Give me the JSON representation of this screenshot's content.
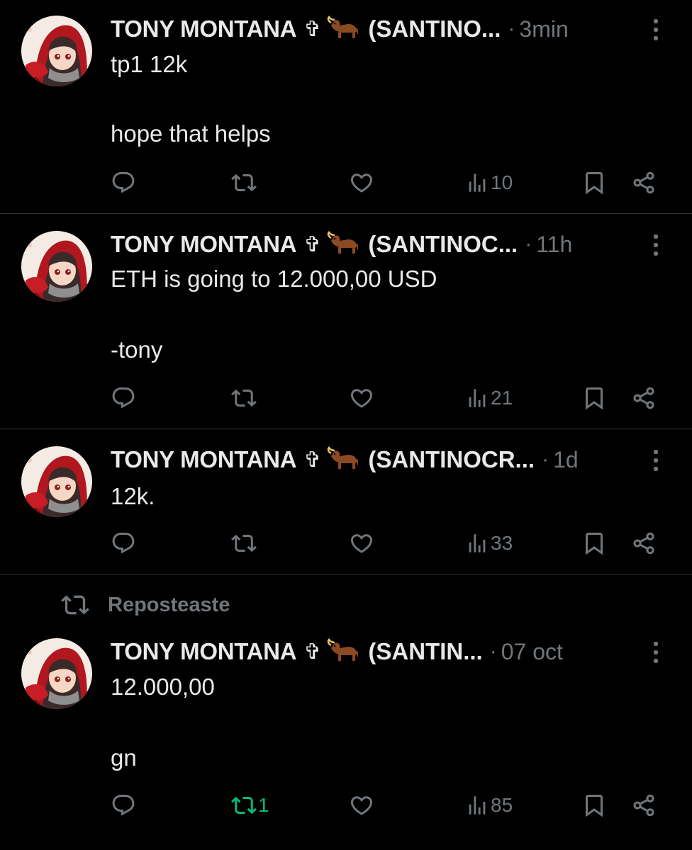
{
  "author": {
    "name": "TONY MONTANA",
    "cross": "✞"
  },
  "tweets": [
    {
      "handle": "(SANTINO...",
      "time": "3min",
      "line1": "tp1 12k",
      "line2": "hope that helps",
      "replies": "",
      "reposts": "",
      "likes": "",
      "views": "10"
    },
    {
      "handle": "(SANTINOC...",
      "time": "11h",
      "line1": "ETH is going to 12.000,00 USD",
      "line2": "-tony",
      "replies": "",
      "reposts": "",
      "likes": "",
      "views": "21"
    },
    {
      "handle": "(SANTINOCR...",
      "time": "1d",
      "line1": "12k.",
      "line2": "",
      "replies": "",
      "reposts": "",
      "likes": "",
      "views": "33"
    },
    {
      "handle": "(SANTIN...",
      "time": "07 oct",
      "line1": "12.000,00",
      "line2": "gn",
      "replies": "",
      "reposts": "1",
      "likes": "",
      "views": "85",
      "reposted_by_you": true
    }
  ],
  "repost_label": "Reposteaste",
  "dot": "·",
  "colors": {
    "background": "#000000",
    "text": "#e7e9ea",
    "muted": "#71767b",
    "divider": "#2f3336",
    "repost_active": "#00ba7c"
  }
}
